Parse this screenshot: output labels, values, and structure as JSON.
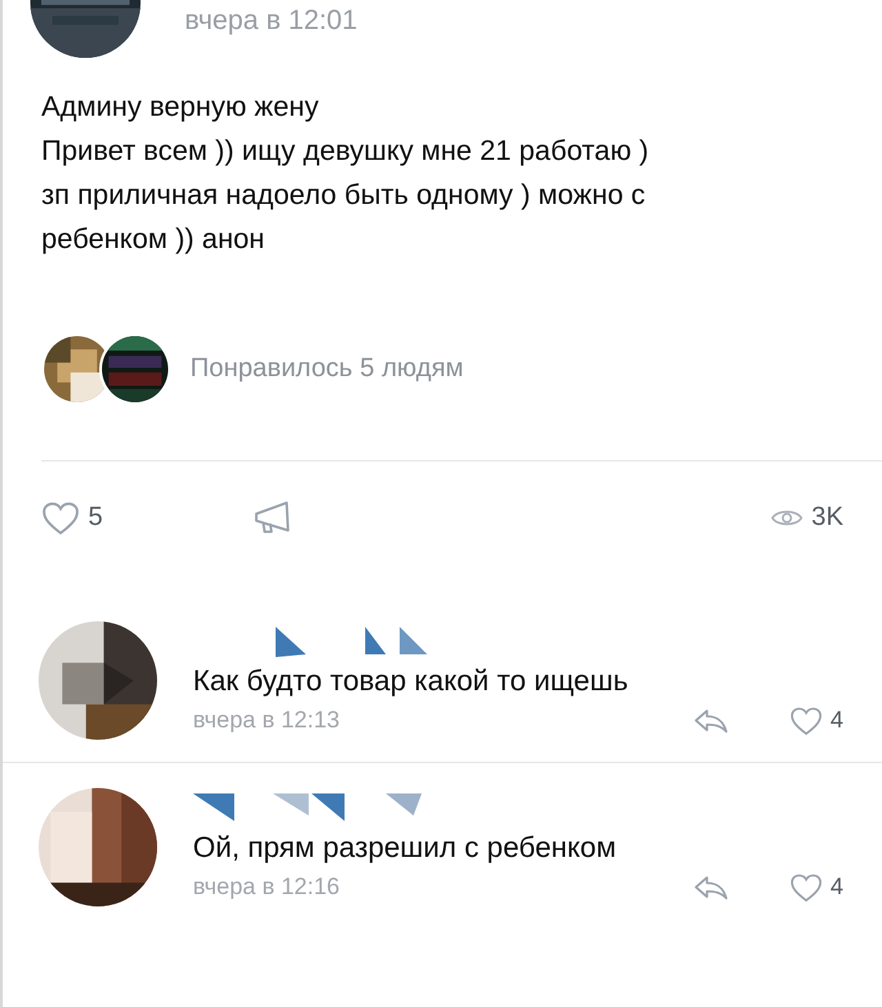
{
  "post": {
    "time": "вчера в 12:01",
    "text": "Админу верную жену\nПривет всем )) ищу девушку мне 21 работаю )\nзп приличная надоело быть одному ) можно с\nребенком )) анон",
    "liked_by": "Понравилось 5 людям",
    "likes": "5",
    "liked": false,
    "views": "3K"
  },
  "comments": [
    {
      "time": "вчера в 12:13",
      "text": "Как будто товар какой то ищешь",
      "likes": "4",
      "liked": false
    },
    {
      "time": "вчера в 12:16",
      "text": "Ой, прям разрешил с ребенком",
      "likes": "4",
      "liked": false
    }
  ]
}
